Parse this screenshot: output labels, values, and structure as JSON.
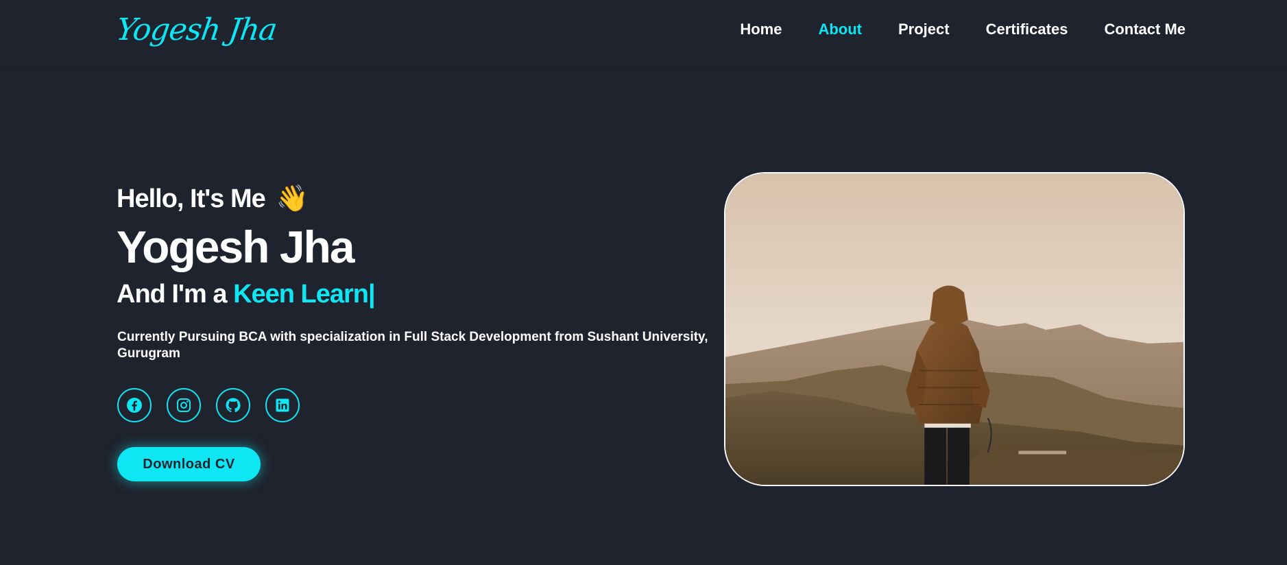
{
  "header": {
    "logo": "Yogesh Jha",
    "nav": [
      {
        "label": "Home",
        "active": false
      },
      {
        "label": "About",
        "active": true
      },
      {
        "label": "Project",
        "active": false
      },
      {
        "label": "Certificates",
        "active": false
      },
      {
        "label": "Contact Me",
        "active": false
      }
    ]
  },
  "hero": {
    "greeting": "Hello, It's Me",
    "wave_emoji": "👋",
    "name": "Yogesh Jha",
    "role_prefix": "And I'm a ",
    "role_typed": "Keen Learn",
    "role_cursor": "|",
    "description": "Currently Pursuing BCA with specialization in Full Stack Development from Sushant University, Gurugram",
    "socials": [
      {
        "icon": "facebook-icon"
      },
      {
        "icon": "instagram-icon"
      },
      {
        "icon": "github-icon"
      },
      {
        "icon": "linkedin-icon"
      }
    ],
    "cv_button": "Download CV"
  },
  "colors": {
    "background": "#1f232d",
    "accent": "#0ee6f3",
    "text": "#ffffff"
  }
}
